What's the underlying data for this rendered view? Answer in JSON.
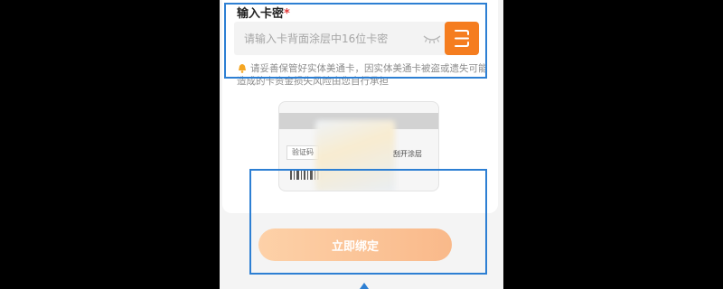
{
  "form": {
    "field_title": "输入卡密",
    "required_mark": "*",
    "input_placeholder": "请输入卡背面涂层中16位卡密",
    "input_value": "",
    "notice_text": "请妥善保管好实体美通卡，因实体美通卡被盗或遗失可能造成的卡资金损失风险由您自行承担"
  },
  "illustration": {
    "verify_code_label": "验证码",
    "scratch_label": "刮开涂层"
  },
  "actions": {
    "bind_now_label": "立即绑定"
  },
  "icons": {
    "visibility": "eye-closed-icon",
    "scan": "scan-icon",
    "notice": "bell-icon"
  },
  "colors": {
    "accent": "#f57d1f",
    "button_gradient_start": "#fdd1a8",
    "button_gradient_end": "#f9b98a",
    "highlight": "#2d7fd3"
  }
}
